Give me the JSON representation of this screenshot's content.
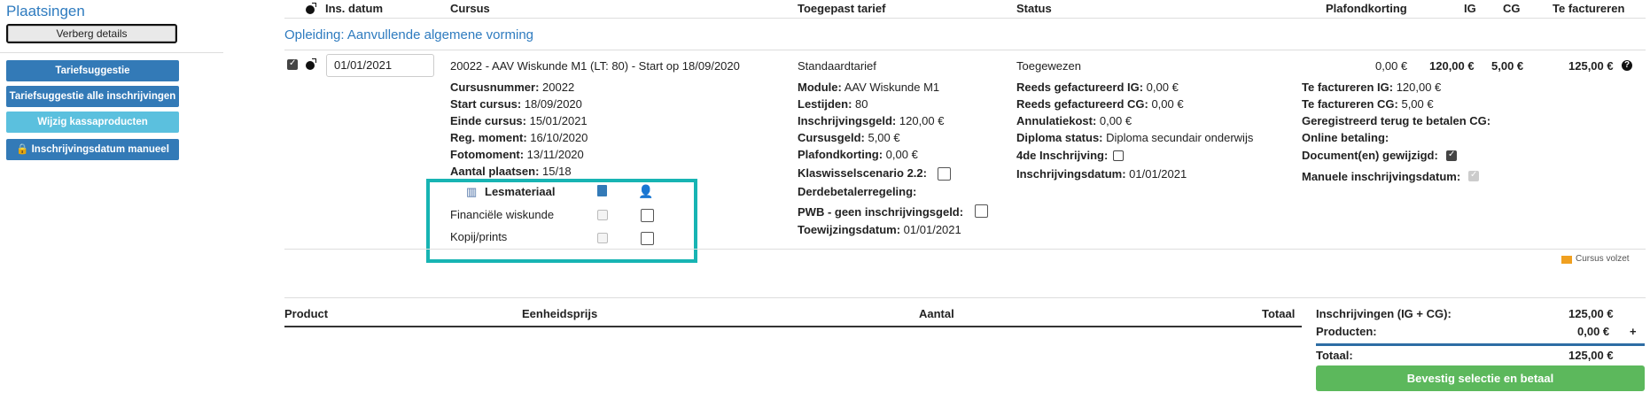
{
  "sidebar": {
    "title": "Plaatsingen",
    "hide_details": "Verberg details",
    "buttons": [
      "Tariefsuggestie",
      "Tariefsuggestie alle inschrijvingen",
      "Wijzig kassaproducten",
      "Inschrijvingsdatum manueel"
    ]
  },
  "table": {
    "headers": {
      "ins_datum": "Ins. datum",
      "cursus": "Cursus",
      "tarief": "Toegepast tarief",
      "status": "Status",
      "plafond": "Plafondkorting",
      "ig": "IG",
      "cg": "CG",
      "factureren": "Te factureren"
    },
    "opleiding": "Opleiding: Aanvullende algemene vorming",
    "row": {
      "date": "01/01/2021",
      "course": "20022 - AAV Wiskunde M1 (LT: 80) - Start op 18/09/2020",
      "tariff": "Standaardtarief",
      "status": "Toegewezen",
      "plafond": "0,00 €",
      "ig": "120,00 €",
      "cg": "5,00 €",
      "factureren": "125,00 €"
    },
    "details": {
      "col1": [
        {
          "k": "Cursusnummer:",
          "v": "20022"
        },
        {
          "k": "Start cursus:",
          "v": "18/09/2020"
        },
        {
          "k": "Einde cursus:",
          "v": "15/01/2021"
        },
        {
          "k": "Reg. moment:",
          "v": "16/10/2020"
        },
        {
          "k": "Fotomoment:",
          "v": "13/11/2020"
        },
        {
          "k": "Aantal plaatsen:",
          "v": "15/18"
        }
      ],
      "col2": [
        {
          "k": "Module:",
          "v": "AAV Wiskunde M1"
        },
        {
          "k": "Lestijden:",
          "v": "80"
        },
        {
          "k": "Inschrijvingsgeld:",
          "v": "120,00 €"
        },
        {
          "k": "Cursusgeld:",
          "v": "5,00 €"
        },
        {
          "k": "Plafondkorting:",
          "v": "0,00 €"
        },
        {
          "k": "Klaswisselscenario 2.2:",
          "v": ""
        },
        {
          "k": "Derdebetalerregeling:",
          "v": ""
        },
        {
          "k": "PWB - geen inschrijvingsgeld:",
          "v": ""
        },
        {
          "k": "Toewijzingsdatum:",
          "v": "01/01/2021"
        }
      ],
      "col3": [
        {
          "k": "Reeds gefactureerd IG:",
          "v": "0,00 €"
        },
        {
          "k": "Reeds gefactureerd CG:",
          "v": "0,00 €"
        },
        {
          "k": "Annulatiekost:",
          "v": "0,00 €"
        },
        {
          "k": "Diploma status:",
          "v": "Diploma secundair onderwijs"
        },
        {
          "k": "4de Inschrijving:",
          "v": ""
        },
        {
          "k": "Inschrijvingsdatum:",
          "v": "01/01/2021"
        }
      ],
      "col4": [
        {
          "k": "Te factureren IG:",
          "v": "120,00 €"
        },
        {
          "k": "Te factureren CG:",
          "v": "5,00 €"
        },
        {
          "k": "Geregistreerd terug te betalen CG:",
          "v": ""
        },
        {
          "k": "Online betaling:",
          "v": ""
        },
        {
          "k": "Document(en) gewijzigd:",
          "v": ""
        },
        {
          "k": "Manuele inschrijvingsdatum:",
          "v": ""
        }
      ]
    },
    "lesmateriaal": {
      "title": "Lesmateriaal",
      "items": [
        "Financiële wiskunde",
        "Kopij/prints"
      ]
    },
    "legend": "Cursus volzet"
  },
  "products": {
    "headers": {
      "product": "Product",
      "prijs": "Eenheidsprijs",
      "aantal": "Aantal",
      "totaal": "Totaal"
    }
  },
  "summary": {
    "inschrijvingen_label": "Inschrijvingen (IG + CG):",
    "inschrijvingen_value": "125,00 €",
    "producten_label": "Producten:",
    "producten_value": "0,00 €",
    "plus": "+",
    "totaal_label": "Totaal:",
    "totaal_value": "125,00 €",
    "confirm": "Bevestig selectie en betaal"
  },
  "colors": {
    "accent": "#337ab7",
    "highlight": "#17b4b3",
    "success": "#5cb85c",
    "volzet": "#f0a020"
  }
}
